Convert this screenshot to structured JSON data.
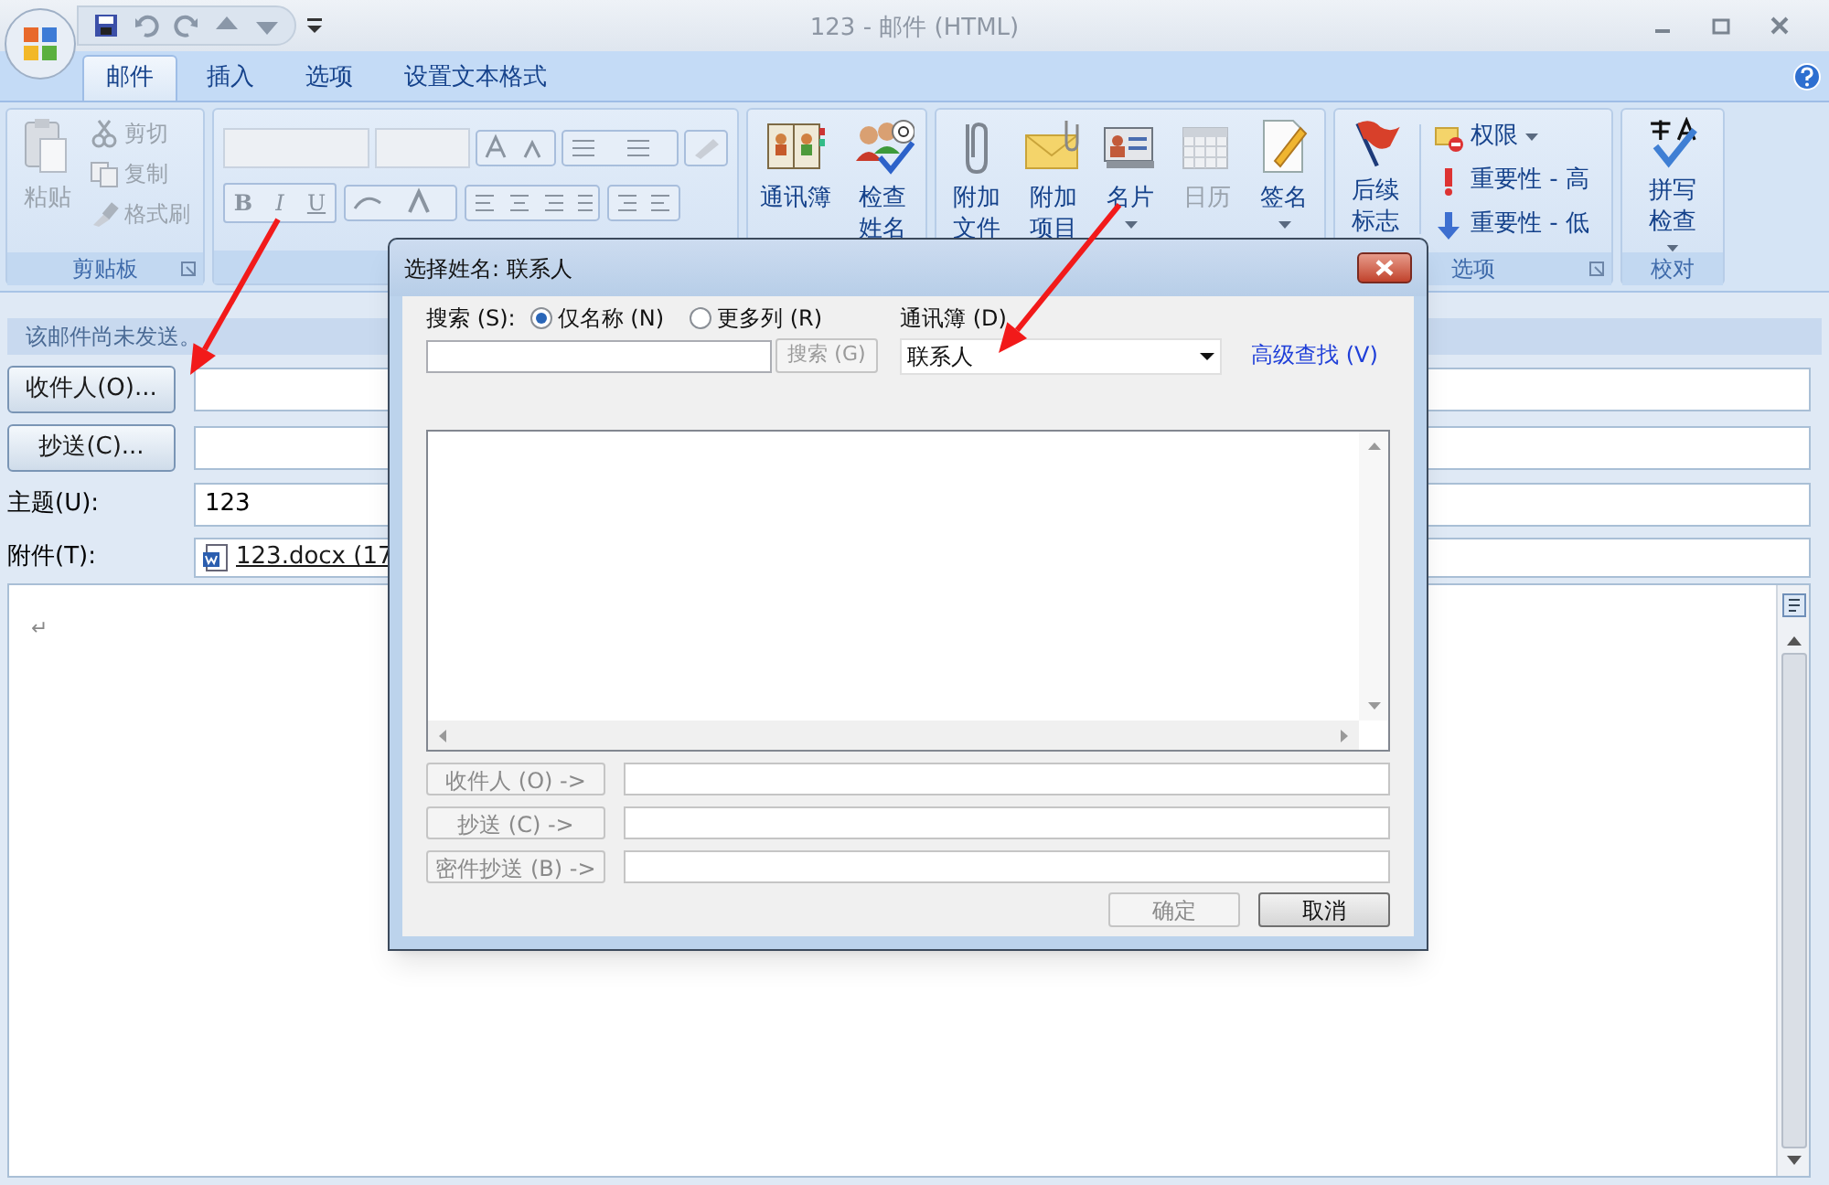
{
  "window": {
    "title": "123 - 邮件 (HTML)"
  },
  "tabs": [
    {
      "label": "邮件",
      "selected": true
    },
    {
      "label": "插入",
      "selected": false
    },
    {
      "label": "选项",
      "selected": false
    },
    {
      "label": "设置文本格式",
      "selected": false
    }
  ],
  "ribbon": {
    "groups": [
      {
        "kind": "clipboard",
        "label": "剪贴板",
        "items": [
          {
            "label": "粘贴",
            "disabled": true
          },
          {
            "label": "剪切",
            "disabled": true
          },
          {
            "label": "复制",
            "disabled": true
          },
          {
            "label": "格式刷",
            "disabled": true
          }
        ]
      },
      {
        "kind": "font",
        "format_buttons": [
          "B",
          "I",
          "U"
        ]
      },
      {
        "kind": "large",
        "items": [
          {
            "label": "通讯簿",
            "disabled": false
          },
          {
            "label": "检查姓名",
            "disabled": false
          }
        ]
      },
      {
        "kind": "large",
        "items": [
          {
            "label": "附加文件",
            "disabled": false
          },
          {
            "label": "附加项目",
            "disabled": false
          },
          {
            "label": "名片",
            "disabled": false,
            "dropdown": true
          },
          {
            "label": "日历",
            "disabled": true
          },
          {
            "label": "签名",
            "disabled": false,
            "dropdown": true
          }
        ]
      },
      {
        "kind": "options",
        "label": "选项",
        "flag": {
          "label": "后续标志"
        },
        "items": [
          {
            "label": "权限",
            "dropdown": true
          },
          {
            "label": "重要性 - 高"
          },
          {
            "label": "重要性 - 低"
          }
        ]
      },
      {
        "kind": "large",
        "label": "校对",
        "items": [
          {
            "label": "拼写检查",
            "disabled": false,
            "dropdown": true
          }
        ]
      }
    ]
  },
  "info_bar": "该邮件尚未发送。",
  "form": {
    "to_button": "收件人(O)...",
    "cc_button": "抄送(C)...",
    "subject_label": "主题(U):",
    "subject": "123",
    "attach_label": "附件(T):",
    "attachment": "123.docx (17"
  },
  "body_mark": "↵",
  "dialog": {
    "title": "选择姓名: 联系人",
    "search_label": "搜索 (S):",
    "radios": [
      {
        "label": "仅名称 (N)",
        "selected": true
      },
      {
        "label": "更多列 (R)",
        "selected": false
      }
    ],
    "search_button": "搜索 (G)",
    "address_book_label": "通讯簿 (D)",
    "address_book": "联系人",
    "advanced_link": "高级查找 (V)",
    "recipient_buttons": [
      "收件人 (O) ->",
      "抄送 (C) ->",
      "密件抄送 (B) ->"
    ],
    "ok": {
      "label": "确定",
      "disabled": true
    },
    "cancel": {
      "label": "取消",
      "disabled": false
    }
  }
}
